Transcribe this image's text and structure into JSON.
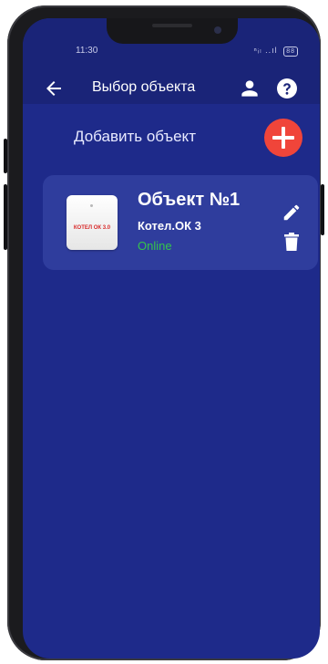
{
  "status_bar": {
    "time": "11:30",
    "signal_text": "ⁿᵢₗ ..ıl",
    "battery": "88"
  },
  "app_bar": {
    "title": "Выбор объекта",
    "back_icon": "arrow-left-icon",
    "user_icon": "person-icon",
    "help_icon": "question-circle-icon"
  },
  "add_object": {
    "label": "Добавить объект",
    "button_icon": "plus-icon",
    "button_color": "#f0453a"
  },
  "objects": [
    {
      "name": "Объект №1",
      "model": "Котел.ОК 3",
      "status": "Online",
      "status_color": "#35c54a",
      "device_logo_text": "КОТЕЛ ОК 3.0",
      "edit_icon": "pencil-icon",
      "delete_icon": "trash-icon"
    }
  ],
  "colors": {
    "background": "#1e2a8a",
    "app_bar": "#1a2478",
    "card": "#2f3d9d"
  }
}
